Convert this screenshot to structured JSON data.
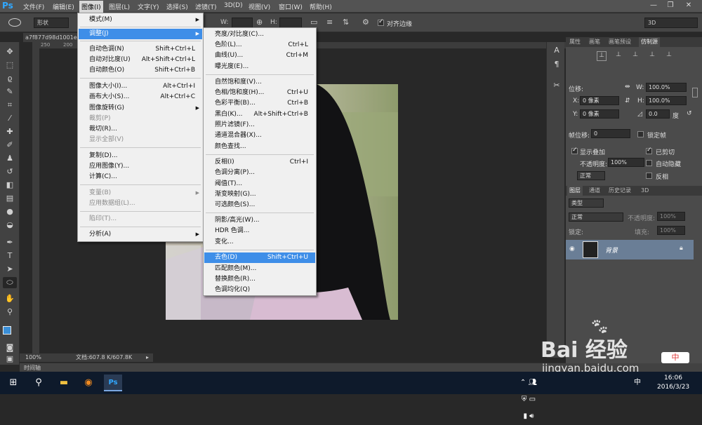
{
  "app": {
    "logo": "Ps"
  },
  "menubar": {
    "items": [
      "文件(F)",
      "编辑(E)",
      "图像(I)",
      "图层(L)",
      "文字(Y)",
      "选择(S)",
      "滤镜(T)",
      "3D(D)",
      "视图(V)",
      "窗口(W)",
      "帮助(H)"
    ],
    "active_index": 2
  },
  "window_controls": {
    "minimize": "—",
    "restore": "❐",
    "close": "✕"
  },
  "options_bar": {
    "shape_mode": "形状",
    "w_label": "W:",
    "h_label": "H:",
    "align_edges_label": "对齐边缘",
    "workspace": "3D"
  },
  "document": {
    "tab_title": "a7f877d98d1001e",
    "ruler_marks": [
      "250",
      "200"
    ]
  },
  "status": {
    "zoom": "100%",
    "doc_size": "文档:607.8 K/607.8K",
    "timeline_tab": "时间轴"
  },
  "image_menu": {
    "items": [
      {
        "label": "模式(M)",
        "shortcut": "",
        "submenu": true,
        "disabled": false
      },
      {
        "label": "调整(J)",
        "shortcut": "",
        "submenu": true,
        "disabled": false,
        "highlighted": true
      },
      {
        "label": "自动色调(N)",
        "shortcut": "Shift+Ctrl+L"
      },
      {
        "label": "自动对比度(U)",
        "shortcut": "Alt+Shift+Ctrl+L"
      },
      {
        "label": "自动颜色(O)",
        "shortcut": "Shift+Ctrl+B"
      },
      {
        "label": "图像大小(I)...",
        "shortcut": "Alt+Ctrl+I"
      },
      {
        "label": "画布大小(S)...",
        "shortcut": "Alt+Ctrl+C"
      },
      {
        "label": "图像旋转(G)",
        "shortcut": "",
        "submenu": true
      },
      {
        "label": "裁剪(P)",
        "shortcut": "",
        "disabled": true
      },
      {
        "label": "裁切(R)...",
        "shortcut": ""
      },
      {
        "label": "显示全部(V)",
        "shortcut": "",
        "disabled": true
      },
      {
        "label": "复制(D)...",
        "shortcut": ""
      },
      {
        "label": "应用图像(Y)...",
        "shortcut": ""
      },
      {
        "label": "计算(C)...",
        "shortcut": ""
      },
      {
        "label": "变量(B)",
        "shortcut": "",
        "submenu": true,
        "disabled": true
      },
      {
        "label": "应用数据组(L)...",
        "shortcut": "",
        "disabled": true
      },
      {
        "label": "陷印(T)...",
        "shortcut": "",
        "disabled": true
      },
      {
        "label": "分析(A)",
        "shortcut": "",
        "submenu": true
      }
    ]
  },
  "adjust_menu": {
    "items": [
      {
        "label": "亮度/对比度(C)...",
        "shortcut": ""
      },
      {
        "label": "色阶(L)...",
        "shortcut": "Ctrl+L"
      },
      {
        "label": "曲线(U)...",
        "shortcut": "Ctrl+M"
      },
      {
        "label": "曝光度(E)...",
        "shortcut": ""
      },
      {
        "label": "自然饱和度(V)...",
        "shortcut": ""
      },
      {
        "label": "色相/饱和度(H)...",
        "shortcut": "Ctrl+U"
      },
      {
        "label": "色彩平衡(B)...",
        "shortcut": "Ctrl+B"
      },
      {
        "label": "黑白(K)...",
        "shortcut": "Alt+Shift+Ctrl+B"
      },
      {
        "label": "照片滤镜(F)...",
        "shortcut": ""
      },
      {
        "label": "通道混合器(X)...",
        "shortcut": ""
      },
      {
        "label": "颜色查找...",
        "shortcut": ""
      },
      {
        "label": "反相(I)",
        "shortcut": "Ctrl+I"
      },
      {
        "label": "色调分离(P)...",
        "shortcut": ""
      },
      {
        "label": "阈值(T)...",
        "shortcut": ""
      },
      {
        "label": "渐变映射(G)...",
        "shortcut": ""
      },
      {
        "label": "可选颜色(S)...",
        "shortcut": ""
      },
      {
        "label": "阴影/高光(W)...",
        "shortcut": ""
      },
      {
        "label": "HDR 色调...",
        "shortcut": ""
      },
      {
        "label": "变化...",
        "shortcut": ""
      },
      {
        "label": "去色(D)",
        "shortcut": "Shift+Ctrl+U",
        "highlighted": true
      },
      {
        "label": "匹配颜色(M)...",
        "shortcut": ""
      },
      {
        "label": "替换颜色(R)...",
        "shortcut": ""
      },
      {
        "label": "色调均化(Q)",
        "shortcut": ""
      }
    ]
  },
  "panels": {
    "top_tabs": [
      "属性",
      "画笔",
      "画笔预设",
      "仿制源"
    ],
    "clone": {
      "offset_label": "位移:",
      "x_label": "X:",
      "x_val": "0 像素",
      "y_label": "Y:",
      "y_val": "0 像素",
      "w_label": "W:",
      "w_val": "100.0%",
      "h_label": "H:",
      "h_val": "100.0%",
      "angle_val": "0.0",
      "angle_unit": "度",
      "frame_offset_label": "帧位移:",
      "frame_offset_val": "0",
      "lock_frame": "锁定帧",
      "show_overlay": "显示叠加",
      "clipped": "已剪切",
      "opacity_label": "不透明度:",
      "opacity_val": "100%",
      "auto_hide": "自动隐藏",
      "blend": "正常",
      "invert": "反相"
    },
    "layer_tabs": [
      "图层",
      "通道",
      "历史记录",
      "3D"
    ],
    "layers": {
      "kind_filter": "类型",
      "blend_mode": "正常",
      "opacity_label": "不透明度:",
      "opacity_val": "100%",
      "lock_label": "锁定:",
      "fill_label": "填充:",
      "fill_val": "100%",
      "layer_name": "背景"
    }
  },
  "taskbar": {
    "time": "16:06",
    "date": "2016/3/23",
    "ime": "中"
  },
  "watermark": {
    "brand": "Bai 经验",
    "url": "jingyan.baidu.com"
  },
  "colors": {
    "menu_highlight": "#3e8ee8",
    "ps_blue": "#31a8ff"
  }
}
